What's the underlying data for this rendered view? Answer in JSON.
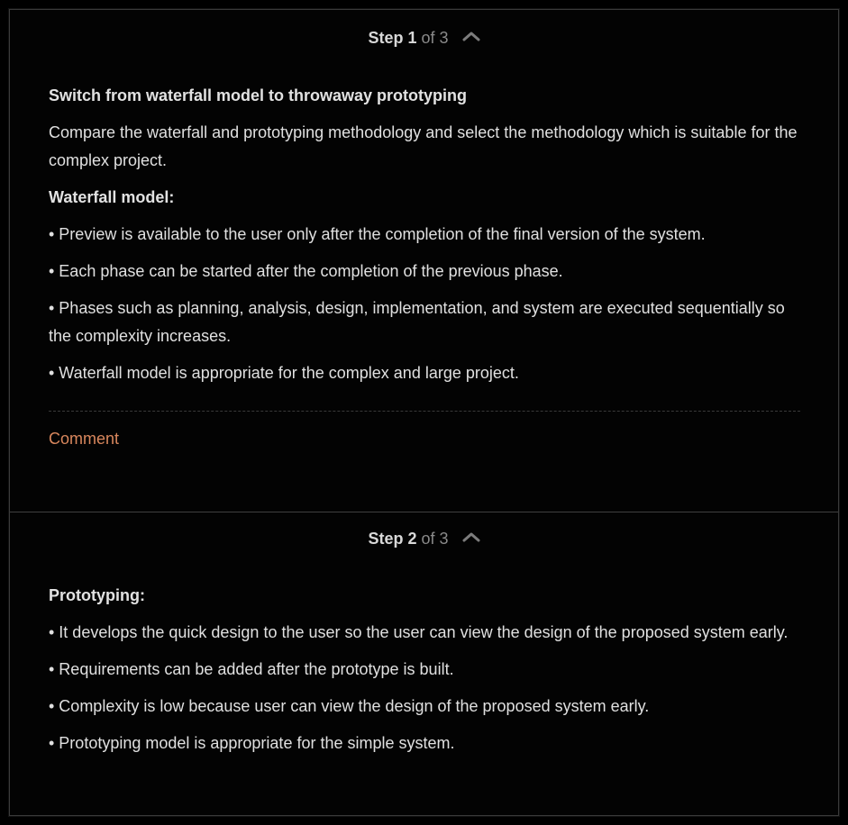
{
  "steps": [
    {
      "label": "Step 1",
      "of": " of 3",
      "title": "Switch from waterfall model to throwaway prototyping",
      "intro": "Compare the waterfall and prototyping methodology and select the methodology which is suitable for the complex project.",
      "heading": "Waterfall model:",
      "bullets": [
        "• Preview is available to the user only after the completion of the final version of the system.",
        "• Each phase can be started after the completion of the previous phase.",
        "• Phases such as planning, analysis, design, implementation, and system are executed sequentially so the complexity increases.",
        "• Waterfall model is appropriate for the complex and large project."
      ],
      "comment_label": "Comment"
    },
    {
      "label": "Step 2",
      "of": " of 3",
      "heading": "Prototyping:",
      "bullets": [
        "• It develops the quick design to the user so the user can view the design of the proposed system early.",
        "• Requirements can be added after the prototype is built.",
        "• Complexity is low because user can view the design of the proposed system early.",
        "• Prototyping model is appropriate for the simple system."
      ]
    }
  ],
  "icons": {
    "collapse": "chevron-up-icon"
  },
  "colors": {
    "background": "#000000",
    "text": "#e0e0e0",
    "muted": "#8a8a8a",
    "accent": "#d9875d"
  }
}
